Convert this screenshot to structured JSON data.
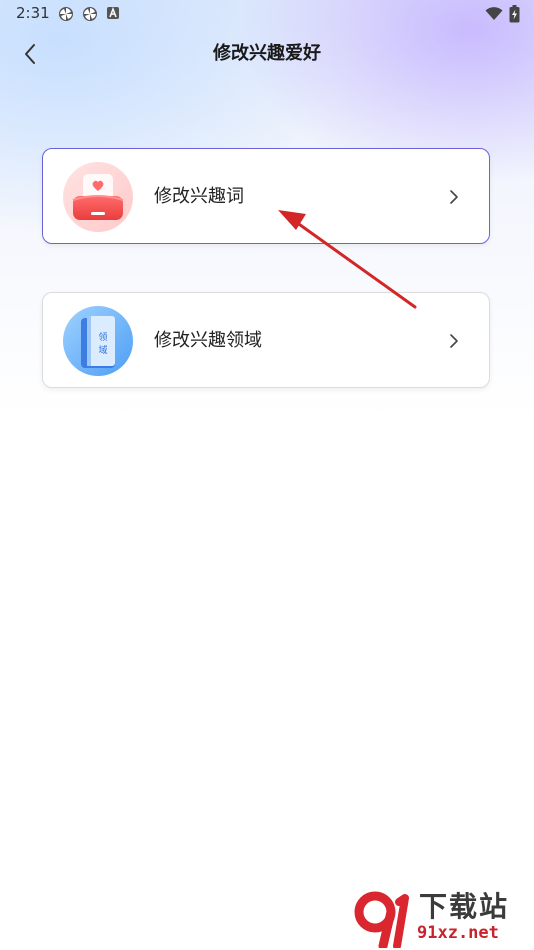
{
  "status_bar": {
    "time": "2:31",
    "icons": [
      "pinwheel-icon",
      "pinwheel-icon",
      "a-badge-icon"
    ],
    "right_icons": [
      "wifi-icon",
      "battery-charging-icon"
    ]
  },
  "header": {
    "title": "修改兴趣爱好",
    "back_icon": "chevron-left-icon"
  },
  "menu": {
    "items": [
      {
        "label": "修改兴趣词",
        "icon": "heart-card-icon",
        "selected": true
      },
      {
        "label": "修改兴趣领域",
        "icon": "field-book-icon",
        "icon_text": "领域",
        "selected": false
      }
    ]
  },
  "watermark": {
    "cn_text": "下载站",
    "url_text": "91xz.net"
  },
  "colors": {
    "accent": "#6b63d9",
    "annotation": "#d32626",
    "watermark_red": "#c8232c"
  }
}
